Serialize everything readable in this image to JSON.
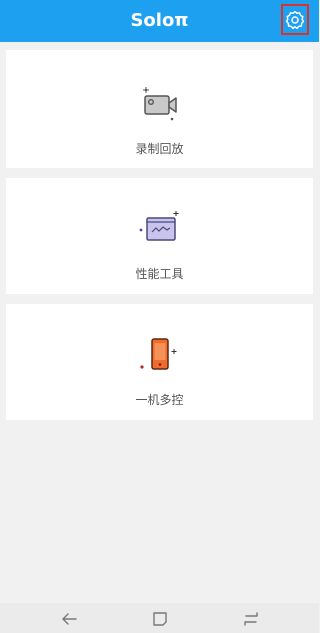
{
  "header": {
    "title": "Soloπ"
  },
  "menu": {
    "items": [
      {
        "label": "录制回放",
        "icon": "video-camera-icon"
      },
      {
        "label": "性能工具",
        "icon": "performance-chart-icon"
      },
      {
        "label": "一机多控",
        "icon": "phone-icon"
      }
    ]
  },
  "colors": {
    "header_bg": "#1ea0f0",
    "page_bg": "#f1f1f1",
    "highlight_border": "#d9342b",
    "phone_orange": "#f36b2b",
    "chart_purple": "#7b6fd0"
  },
  "icons": {
    "settings": "gear-icon",
    "nav_back": "back-arrow-icon",
    "nav_home": "home-square-icon",
    "nav_recent": "recent-apps-icon"
  }
}
